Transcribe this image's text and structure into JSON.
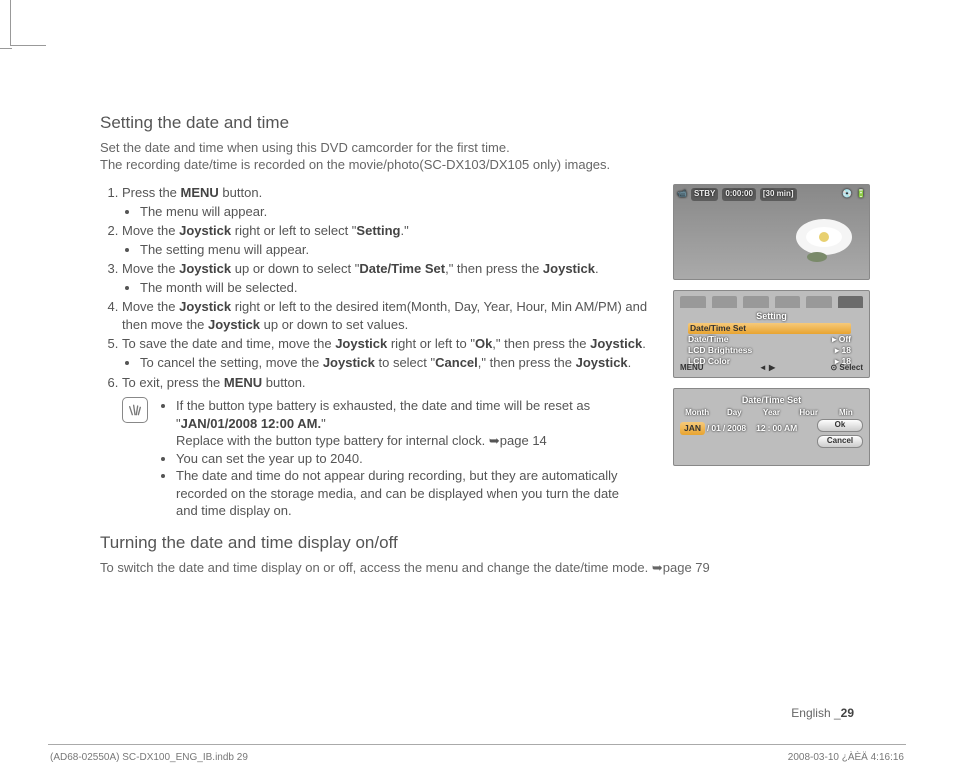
{
  "headings": {
    "h1": "Setting the date and time",
    "h2": "Turning the date and time display on/off"
  },
  "intro": {
    "l1": "Set the date and time when using this DVD camcorder for the first time.",
    "l2": "The recording date/time is recorded on the movie/photo(SC-DX103/DX105 only) images."
  },
  "steps": {
    "s1": "Press the <b>MENU</b> button.",
    "s1a": "The menu will appear.",
    "s2": "Move the <b>Joystick</b> right or left to select \"<b>Setting</b>.\"",
    "s2a": "The setting menu will appear.",
    "s3": "Move the <b>Joystick</b> up or down to select \"<b>Date/Time Set</b>,\" then press the <b>Joystick</b>.",
    "s3a": "The month will be selected.",
    "s4": "Move the <b>Joystick</b> right or left to the desired item(Month, Day, Year, Hour, Min AM/PM) and then move the <b>Joystick</b> up or down to set values.",
    "s5": "To save the date and time, move the <b>Joystick</b> right or left to \"<b>Ok</b>,\" then press the <b>Joystick</b>.",
    "s5a": "To cancel the setting, move the <b>Joystick</b> to select \"<b>Cancel</b>,\" then press the <b>Joystick</b>.",
    "s6": "To exit, press the <b>MENU</b> button."
  },
  "notes": {
    "n1": "If the button type battery is exhausted, the date and time will be reset as \"<b>JAN/01/2008 12:00 AM.</b>\"",
    "n1b": "Replace with the button type battery for internal clock. ➥page 14",
    "n2": "You can set the year up to 2040.",
    "n3": "The date and time do not appear during recording, but they are automatically recorded on the storage media, and can be displayed when you turn the date and time display on."
  },
  "onoff": "To switch the date and time display on or off, access the menu and change the date/time mode. ➥page 79",
  "screens": {
    "top": {
      "stby": "STBY",
      "time": "0:00:00",
      "remain": "[30 min]"
    },
    "menu": {
      "title": "Setting",
      "items": [
        {
          "label": "Date/Time Set",
          "val": ""
        },
        {
          "label": "Date/Time",
          "val": "Off"
        },
        {
          "label": "LCD Brightness",
          "val": "18"
        },
        {
          "label": "LCD Color",
          "val": "18"
        }
      ],
      "bottom": {
        "left": "MENU",
        "mid": "◄ ▶",
        "right": "⊙ Select"
      }
    },
    "dts": {
      "title": "Date/Time Set",
      "cols": [
        "Month",
        "Day",
        "Year",
        "Hour",
        "Min"
      ],
      "vals": {
        "month": "JAN",
        "day": "01",
        "year": "2008",
        "hour": "12",
        "min": "00",
        "ampm": "AM"
      },
      "ok": "Ok",
      "cancel": "Cancel"
    }
  },
  "footer": {
    "lang": "English _",
    "page": "29"
  },
  "meta": {
    "left": "(AD68-02550A) SC-DX100_ENG_IB.indb   29",
    "right": "2008-03-10   ¿ÀÈÄ 4:16:16"
  }
}
